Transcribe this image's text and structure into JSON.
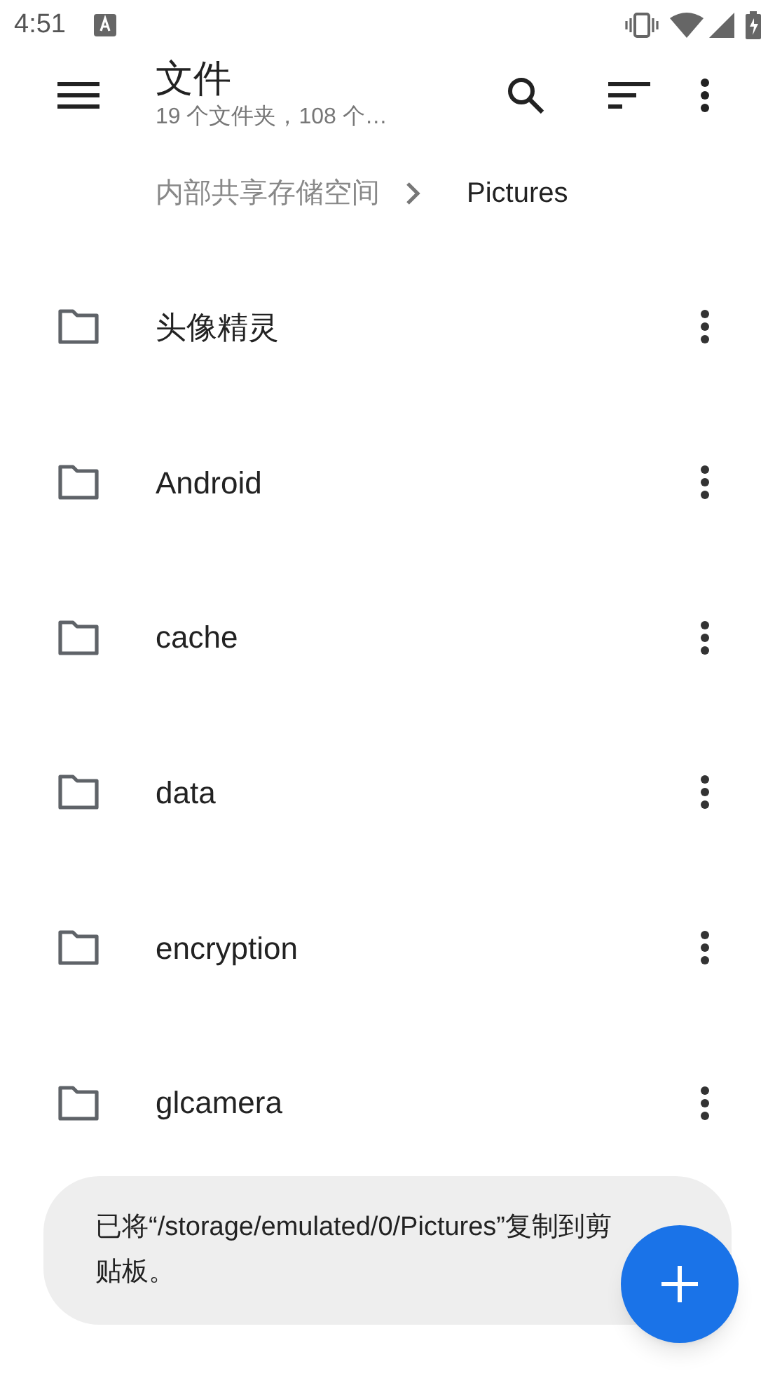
{
  "status_bar": {
    "time": "4:51"
  },
  "app_bar": {
    "title": "文件",
    "subtitle": "19 个文件夹，108 个…"
  },
  "breadcrumb": [
    {
      "label": "内部共享存储空间",
      "selected": false
    },
    {
      "label": "Pictures",
      "selected": true
    }
  ],
  "folders": [
    {
      "name": "头像精灵"
    },
    {
      "name": "Android"
    },
    {
      "name": "cache"
    },
    {
      "name": "data"
    },
    {
      "name": "encryption"
    },
    {
      "name": "glcamera"
    }
  ],
  "toast": {
    "message": "已将“/storage/emulated/0/Pictures”复制到剪贴板。"
  }
}
